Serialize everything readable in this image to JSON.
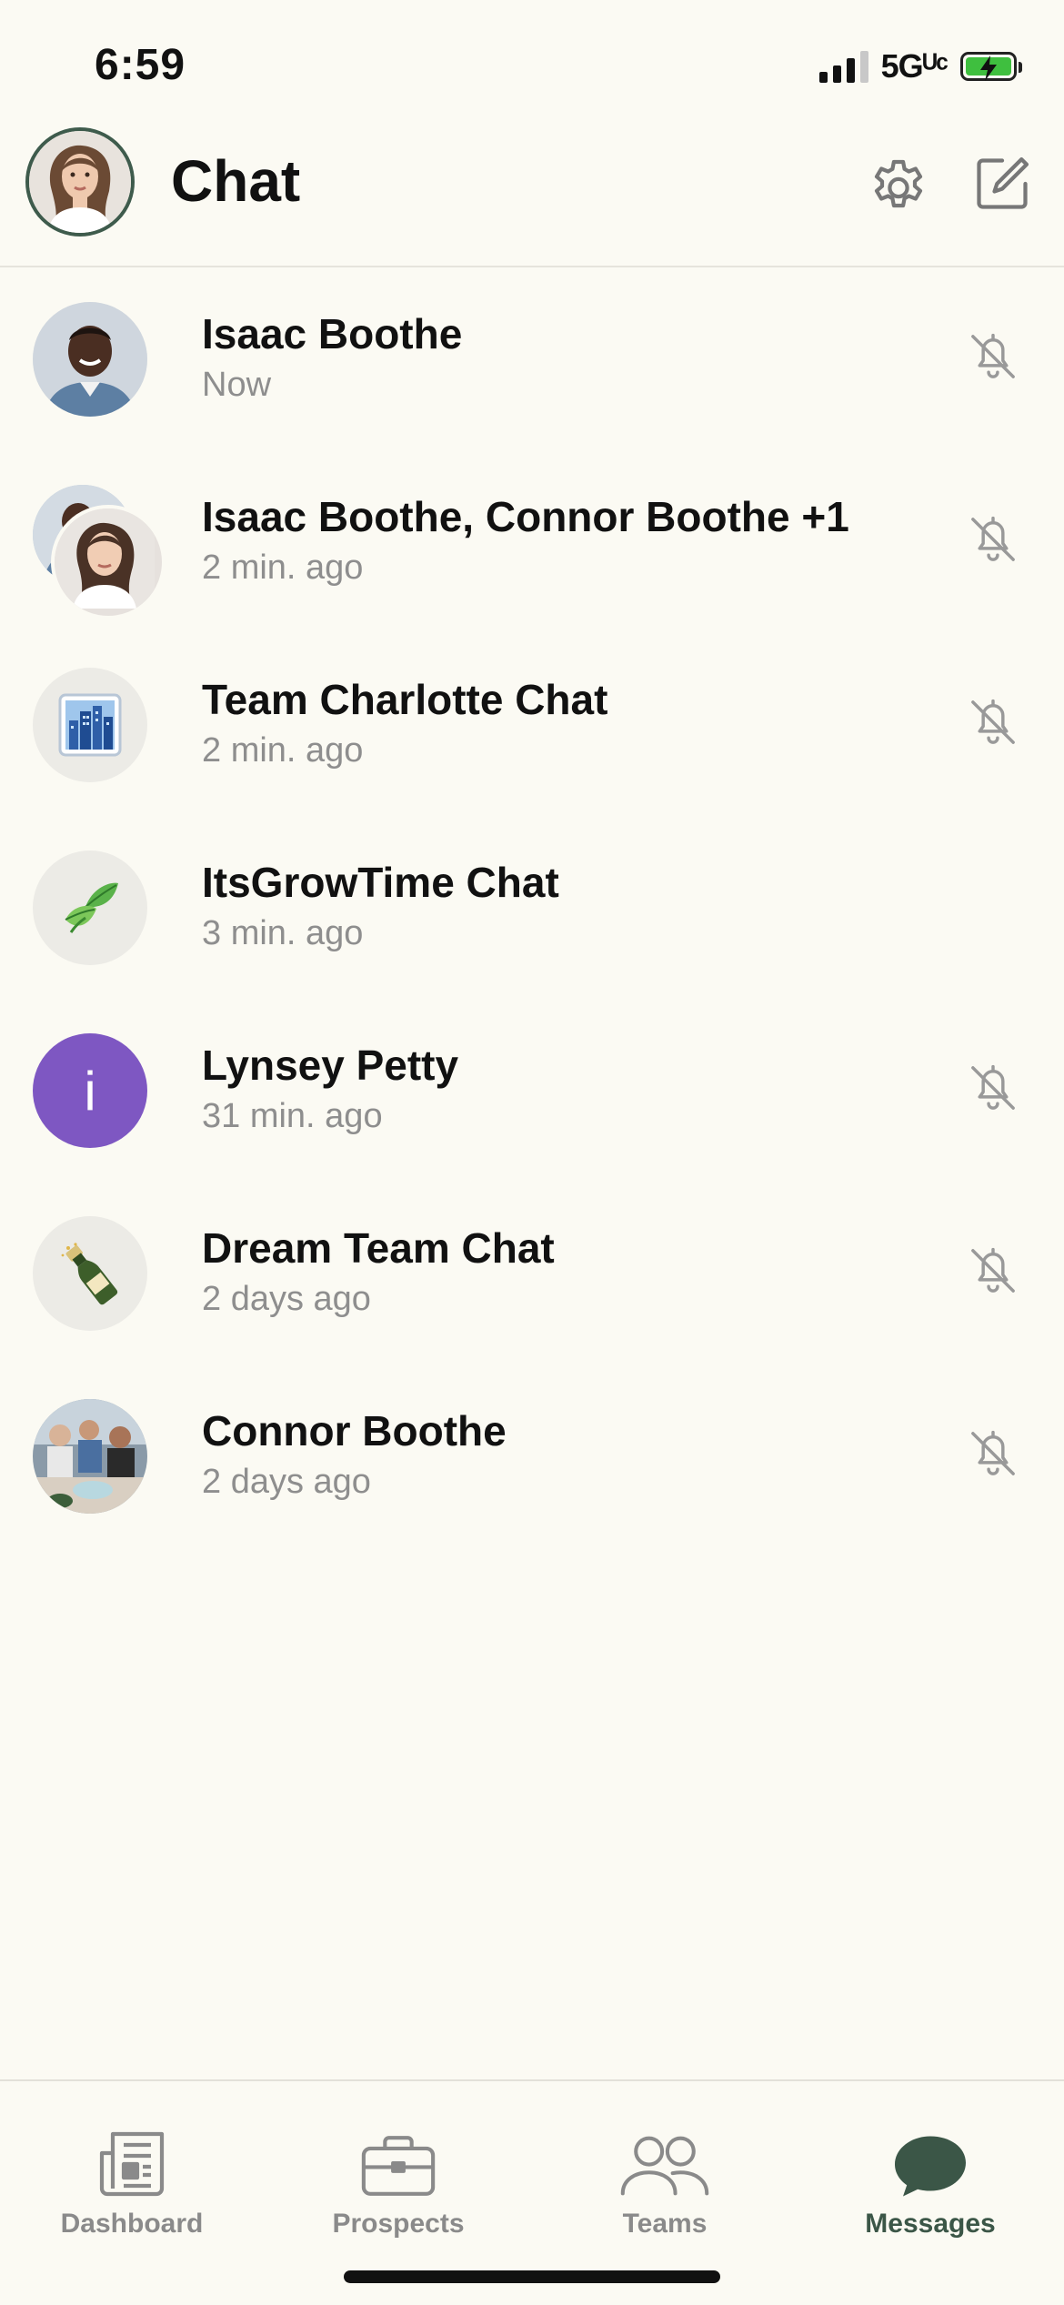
{
  "status_bar": {
    "time": "6:59",
    "network": "5Gᵁᶜ"
  },
  "header": {
    "title": "Chat",
    "avatar": "profile-photo",
    "settings_icon": "gear-icon",
    "compose_icon": "compose-icon"
  },
  "chats": [
    {
      "name": "Isaac Boothe",
      "time": "Now",
      "avatar": "photo",
      "muted": true
    },
    {
      "name": "Isaac Boothe,  Connor Boothe +1",
      "time": "2 min. ago",
      "avatar": "group-photo",
      "muted": true
    },
    {
      "name": "Team Charlotte Chat",
      "time": "2 min. ago",
      "avatar": "cityscape-emoji",
      "muted": true
    },
    {
      "name": "ItsGrowTime Chat",
      "time": "3 min. ago",
      "avatar": "leaf-emoji",
      "muted": false
    },
    {
      "name": "Lynsey Petty",
      "time": "31 min. ago",
      "avatar": "initial",
      "initial": "i",
      "muted": true
    },
    {
      "name": "Dream Team Chat",
      "time": "2 days ago",
      "avatar": "champagne-emoji",
      "muted": true
    },
    {
      "name": "Connor Boothe",
      "time": "2 days ago",
      "avatar": "photo",
      "muted": true
    }
  ],
  "tabs": [
    {
      "label": "Dashboard",
      "icon": "newspaper-icon",
      "active": false
    },
    {
      "label": "Prospects",
      "icon": "briefcase-icon",
      "active": false
    },
    {
      "label": "Teams",
      "icon": "people-icon",
      "active": false
    },
    {
      "label": "Messages",
      "icon": "chat-bubble-icon",
      "active": true
    }
  ],
  "colors": {
    "background": "#fbfaf3",
    "accent": "#3b5647",
    "initial_avatar": "#7e57c2",
    "muted_text": "#8e8e8e"
  }
}
